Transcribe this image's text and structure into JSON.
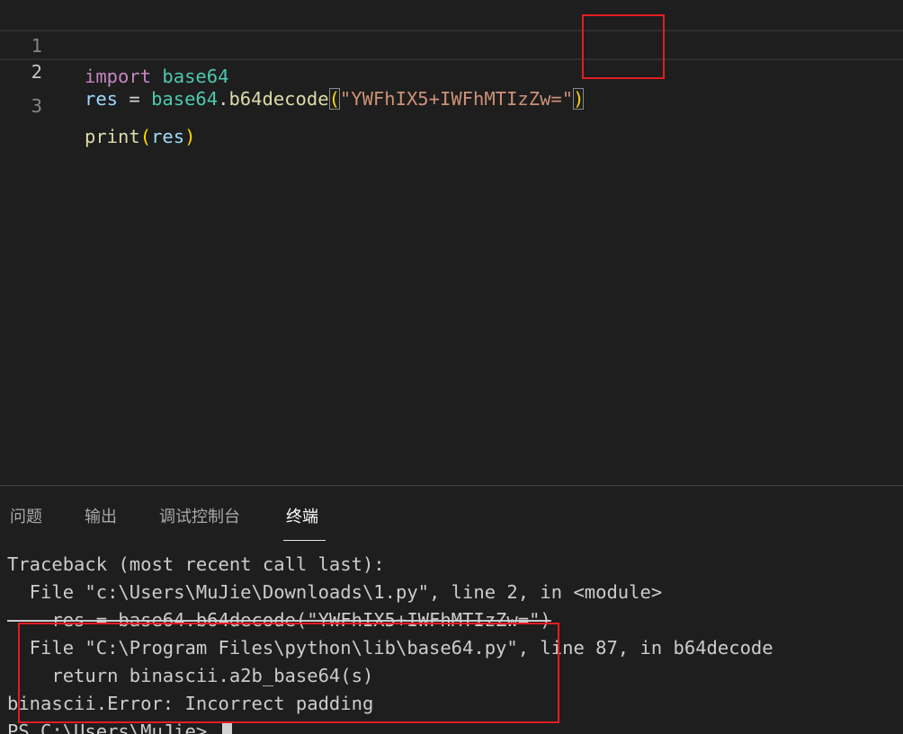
{
  "editor": {
    "lines": [
      {
        "number": "1",
        "tokens": {
          "t1": "import",
          "t2": " ",
          "t3": "base64"
        }
      },
      {
        "number": "2",
        "tokens": {
          "t1": "res",
          "t2": " = ",
          "t3": "base64",
          "t4": ".",
          "t5": "b64decode",
          "t6": "(",
          "t7": "\"YWFhIX5+IWFhMTIzZw=\"",
          "t8": ")"
        }
      },
      {
        "number": "3",
        "tokens": {
          "t1": "print",
          "t2": "(",
          "t3": "res",
          "t4": ")"
        }
      }
    ]
  },
  "panel": {
    "tabs": [
      {
        "label": "问题"
      },
      {
        "label": "输出"
      },
      {
        "label": "调试控制台"
      },
      {
        "label": "终端"
      }
    ],
    "active_tab": "终端",
    "terminal": {
      "lines": [
        "Traceback (most recent call last):",
        "  File \"c:\\Users\\MuJie\\Downloads\\1.py\", line 2, in <module>",
        "    res = base64.b64decode(\"YWFhIX5+IWFhMTIzZw=\")",
        "  File \"C:\\Program Files\\python\\lib\\base64.py\", line 87, in b64decode",
        "    return binascii.a2b_base64(s)",
        "binascii.Error: Incorrect padding",
        "PS C:\\Users\\MuJie> "
      ]
    }
  },
  "colors": {
    "background": "#1e1e1e",
    "annotation": "#e51c23",
    "keyword": "#c586c0",
    "module": "#4ec9b0",
    "variable": "#9cdcfe",
    "function": "#dcdcaa",
    "string": "#ce9178",
    "bracket": "#ffd700"
  }
}
